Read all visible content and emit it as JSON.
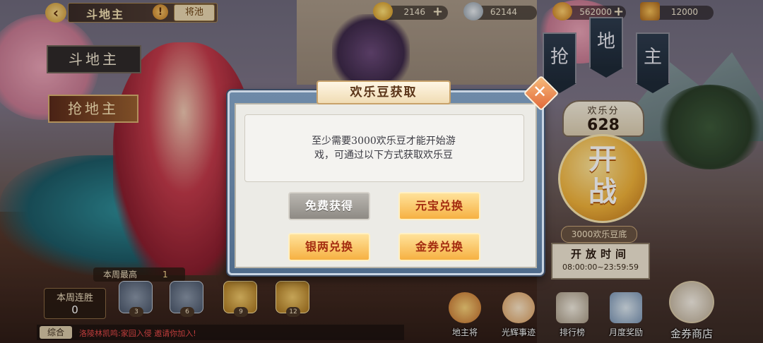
{
  "topbar": {
    "title": "斗地主",
    "alert_icon": "!",
    "pool_label": "将池",
    "resources": [
      {
        "icon": "gold-ingot-icon",
        "value": "2146"
      },
      {
        "icon": "silver-ingot-icon",
        "value": "62144"
      },
      {
        "icon": "gold-bean-icon",
        "value": "562000"
      },
      {
        "icon": "gold-ticket-icon",
        "value": "12000"
      }
    ]
  },
  "left_signs": {
    "doudizhu": "斗地主",
    "qiangdizhu": "抢地主"
  },
  "right_banners": [
    "抢",
    "地",
    "主"
  ],
  "score": {
    "label": "欢乐分",
    "value": "628"
  },
  "start_button": {
    "line1": "开",
    "line2": "战"
  },
  "cost_tag": "3000欢乐豆底",
  "open_time": {
    "label": "开放时间",
    "range": "08:00:00~23:59:59"
  },
  "stats": {
    "week_best_label": "本周最高",
    "week_best_value": "1",
    "streak_label": "本周连胜",
    "streak_value": "0",
    "chests": [
      "3",
      "6",
      "9",
      "12"
    ]
  },
  "chat": {
    "tab": "综合",
    "text": "洛陵林凯鸣:家园入侵 邀请你加入!"
  },
  "menu": [
    {
      "label": "地主将",
      "icon": "landlord-cat-icon"
    },
    {
      "label": "光辉事迹",
      "icon": "glory-cat-icon"
    },
    {
      "label": "排行榜",
      "icon": "ranking-icon"
    },
    {
      "label": "月度奖励",
      "icon": "monthly-reward-icon"
    }
  ],
  "shop_label": "金券商店",
  "dialog": {
    "title": "欢乐豆获取",
    "message_line1": "至少需要3000欢乐豆才能开始游",
    "message_line2": "戏，可通过以下方式获取欢乐豆",
    "buttons": {
      "free": "免费获得",
      "yuanbao": "元宝兑换",
      "silver": "银两兑换",
      "ticket": "金券兑换"
    }
  },
  "colors": {
    "dialog_frame": "#6e8aa8",
    "gold_button": "#f6b142",
    "gray_button": "#8e8a84",
    "close_button": "#e26a3a"
  }
}
